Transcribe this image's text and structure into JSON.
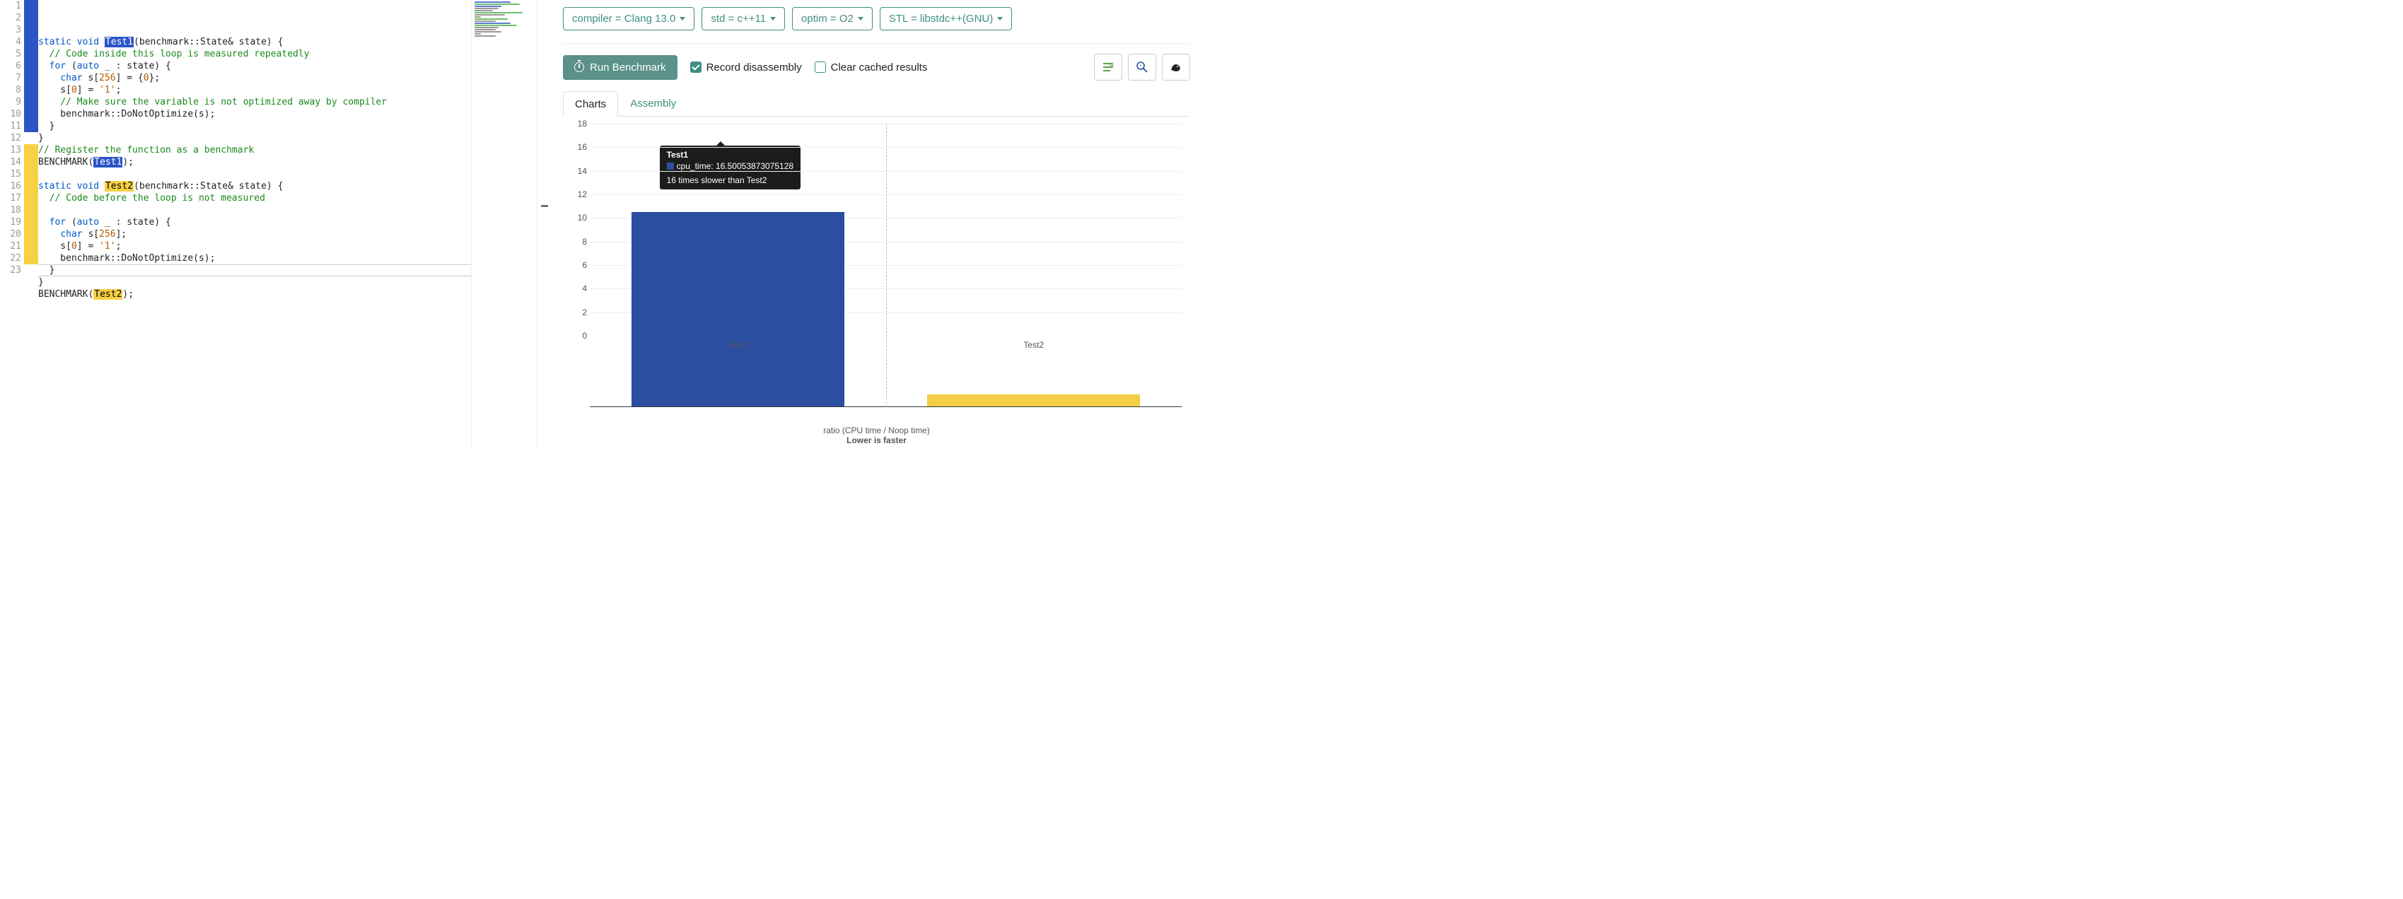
{
  "editor": {
    "lines": [
      {
        "n": 1,
        "marker": "blue",
        "html": "<span class='tok-kw'>static</span> <span class='tok-kw'>void</span> <span class='hl-blue'>Test1</span>(benchmark::State&amp; state) {"
      },
      {
        "n": 2,
        "marker": "blue",
        "html": "  <span class='tok-comment'>// Code inside this loop is measured repeatedly</span>"
      },
      {
        "n": 3,
        "marker": "blue",
        "html": "  <span class='tok-kw'>for</span> (<span class='tok-kw'>auto</span> _ : state) {"
      },
      {
        "n": 4,
        "marker": "blue",
        "html": "    <span class='tok-kw'>char</span> s[<span class='tok-num'>256</span>] = {<span class='tok-num'>0</span>};"
      },
      {
        "n": 5,
        "marker": "blue",
        "html": "    s[<span class='tok-num'>0</span>] = <span class='tok-str'>'1'</span>;"
      },
      {
        "n": 6,
        "marker": "blue",
        "html": "    <span class='tok-comment'>// Make sure the variable is not optimized away by compiler</span>"
      },
      {
        "n": 7,
        "marker": "blue",
        "html": "    benchmark::DoNotOptimize(s);"
      },
      {
        "n": 8,
        "marker": "blue",
        "html": "  }"
      },
      {
        "n": 9,
        "marker": "blue",
        "html": "}"
      },
      {
        "n": 10,
        "marker": "blue",
        "html": "<span class='tok-comment'>// Register the function as a benchmark</span>"
      },
      {
        "n": 11,
        "marker": "blue",
        "html": "BENCHMARK(<span class='hl-blue'>Test1</span>);"
      },
      {
        "n": 12,
        "marker": "",
        "html": ""
      },
      {
        "n": 13,
        "marker": "yellow",
        "html": "<span class='tok-kw'>static</span> <span class='tok-kw'>void</span> <span class='hl-yellow'>Test2</span>(benchmark::State&amp; state) {"
      },
      {
        "n": 14,
        "marker": "yellow",
        "html": "  <span class='tok-comment'>// Code before the loop is not measured</span>"
      },
      {
        "n": 15,
        "marker": "yellow",
        "html": ""
      },
      {
        "n": 16,
        "marker": "yellow",
        "html": "  <span class='tok-kw'>for</span> (<span class='tok-kw'>auto</span> _ : state) {"
      },
      {
        "n": 17,
        "marker": "yellow",
        "html": "    <span class='tok-kw'>char</span> s[<span class='tok-num'>256</span>];"
      },
      {
        "n": 18,
        "marker": "yellow",
        "html": "    s[<span class='tok-num'>0</span>] = <span class='tok-str'>'1'</span>;"
      },
      {
        "n": 19,
        "marker": "yellow",
        "html": "    benchmark::DoNotOptimize(s);"
      },
      {
        "n": 20,
        "marker": "yellow",
        "html": "  }"
      },
      {
        "n": 21,
        "marker": "yellow",
        "html": "}"
      },
      {
        "n": 22,
        "marker": "yellow",
        "html": "BENCHMARK(<span class='hl-yellow'>Test2</span>);"
      },
      {
        "n": 23,
        "marker": "",
        "html": ""
      }
    ],
    "active_line": 23
  },
  "controls": {
    "compiler": "compiler = Clang 13.0",
    "std": "std = c++11",
    "optim": "optim = O2",
    "stl": "STL = libstdc++(GNU)",
    "run_label": "Run Benchmark",
    "record_label": "Record disassembly",
    "record_checked": true,
    "clear_label": "Clear cached results",
    "clear_checked": false
  },
  "tabs": {
    "charts": "Charts",
    "assembly": "Assembly",
    "active": "charts"
  },
  "tooltip": {
    "title": "Test1",
    "series": "cpu_time: 16.50053873075128",
    "note": "16 times slower than Test2"
  },
  "axis": {
    "title1": "ratio (CPU time / Noop time)",
    "title2": "Lower is faster"
  },
  "chart_data": {
    "type": "bar",
    "categories": [
      "Test1",
      "Test2"
    ],
    "values": [
      16.50053873075128,
      1.0
    ],
    "series_name": "cpu_time",
    "ylim": [
      0,
      18
    ],
    "yticks": [
      0,
      2,
      4,
      6,
      8,
      10,
      12,
      14,
      16,
      18
    ],
    "colors": [
      "#2c4ea0",
      "#f3cf45"
    ],
    "xlabel": "",
    "ylabel": "",
    "title": "ratio (CPU time / Noop time) — Lower is faster"
  }
}
